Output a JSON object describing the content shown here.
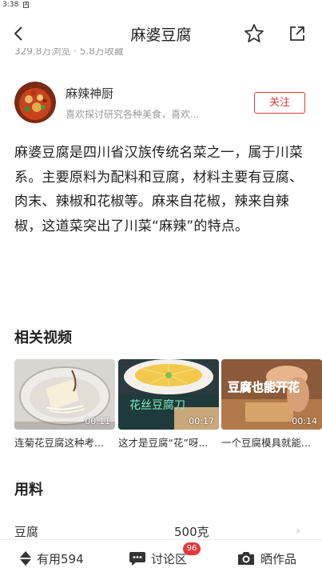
{
  "status_bar": {
    "time": "3:38",
    "sim_label": "A"
  },
  "header": {
    "title": "麻婆豆腐"
  },
  "stats": {
    "partial_text": "329.8万浏览 · 5.8万收藏"
  },
  "author": {
    "name": "麻辣神厨",
    "description": "喜欢探讨研究各种美食，喜欢...",
    "follow_label": "关注"
  },
  "intro": {
    "text": "麻婆豆腐是四川省汉族传统名菜之一，属于川菜系。主要原料为配料和豆腐，材料主要有豆腐、肉末、辣椒和花椒等。麻来自花椒，辣来自辣椒，这道菜突出了川菜“麻辣”的特点。"
  },
  "videos": {
    "title": "相关视频",
    "items": [
      {
        "caption": "连菊花豆腐这种考...",
        "duration": "00:11",
        "thumb_text": ""
      },
      {
        "caption": "这才是豆腐“花”呀...",
        "duration": "00:17",
        "thumb_text": "花丝豆腐刀"
      },
      {
        "caption": "一个豆腐模具就能...",
        "duration": "00:14",
        "thumb_text": "豆腐也能开花"
      }
    ]
  },
  "ingredients": {
    "title": "用料",
    "items": [
      {
        "name": "豆腐",
        "quantity": "500克"
      }
    ]
  },
  "bottom_bar": {
    "useful_label": "有用594",
    "discuss_label": "讨论区",
    "discuss_badge": "96",
    "photo_label": "晒作品"
  },
  "colors": {
    "accent": "#e4393c",
    "text": "#222222",
    "muted": "#999999"
  }
}
